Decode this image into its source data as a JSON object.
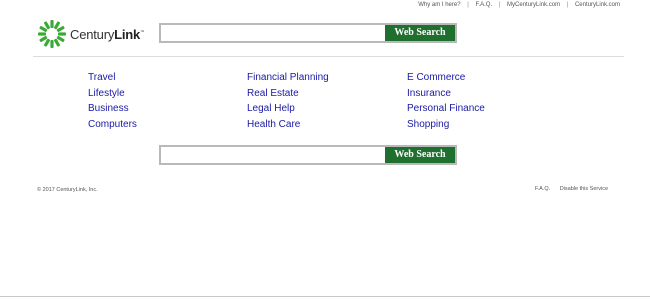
{
  "top_links": [
    "Why am I here?",
    "F.A.Q.",
    "MyCenturyLink.com",
    "CenturyLink.com"
  ],
  "brand": {
    "name_regular": "Century",
    "name_bold": "Link",
    "trademark": "™",
    "logo_color": "#3aaa35"
  },
  "search": {
    "top": {
      "placeholder": "",
      "button_label": "Web Search"
    },
    "bottom": {
      "placeholder": "",
      "button_label": "Web Search"
    },
    "button_color": "#1f6f2f"
  },
  "categories": {
    "col1": [
      "Travel",
      "Lifestyle",
      "Business",
      "Computers"
    ],
    "col2": [
      "Financial Planning",
      "Real Estate",
      "Legal Help",
      "Health Care"
    ],
    "col3": [
      "E Commerce",
      "Insurance",
      "Personal Finance",
      "Shopping"
    ]
  },
  "footer": {
    "copyright": "© 2017 CenturyLink, Inc.",
    "links": [
      "F.A.Q.",
      "Disable this Service"
    ]
  }
}
